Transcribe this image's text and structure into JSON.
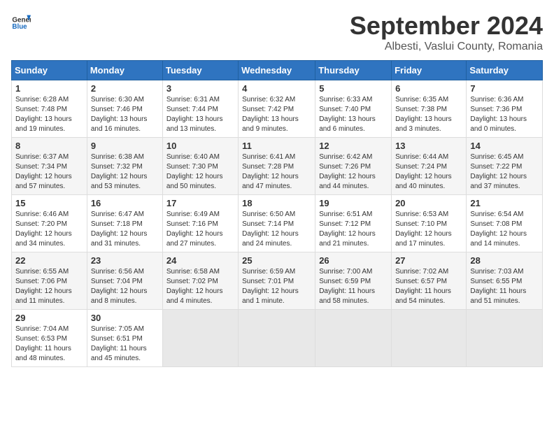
{
  "header": {
    "logo_general": "General",
    "logo_blue": "Blue",
    "title": "September 2024",
    "subtitle": "Albesti, Vaslui County, Romania"
  },
  "calendar": {
    "days_of_week": [
      "Sunday",
      "Monday",
      "Tuesday",
      "Wednesday",
      "Thursday",
      "Friday",
      "Saturday"
    ],
    "weeks": [
      [
        {
          "day": "",
          "sunrise": "",
          "sunset": "",
          "daylight": "",
          "empty": true
        },
        {
          "day": "",
          "sunrise": "",
          "sunset": "",
          "daylight": "",
          "empty": true
        },
        {
          "day": "",
          "sunrise": "",
          "sunset": "",
          "daylight": "",
          "empty": true
        },
        {
          "day": "",
          "sunrise": "",
          "sunset": "",
          "daylight": "",
          "empty": true
        },
        {
          "day": "",
          "sunrise": "",
          "sunset": "",
          "daylight": "",
          "empty": true
        },
        {
          "day": "",
          "sunrise": "",
          "sunset": "",
          "daylight": "",
          "empty": true
        },
        {
          "day": "",
          "sunrise": "",
          "sunset": "",
          "daylight": "",
          "empty": true
        }
      ],
      [
        {
          "day": "1",
          "sunrise": "Sunrise: 6:28 AM",
          "sunset": "Sunset: 7:48 PM",
          "daylight": "Daylight: 13 hours and 19 minutes.",
          "empty": false
        },
        {
          "day": "2",
          "sunrise": "Sunrise: 6:30 AM",
          "sunset": "Sunset: 7:46 PM",
          "daylight": "Daylight: 13 hours and 16 minutes.",
          "empty": false
        },
        {
          "day": "3",
          "sunrise": "Sunrise: 6:31 AM",
          "sunset": "Sunset: 7:44 PM",
          "daylight": "Daylight: 13 hours and 13 minutes.",
          "empty": false
        },
        {
          "day": "4",
          "sunrise": "Sunrise: 6:32 AM",
          "sunset": "Sunset: 7:42 PM",
          "daylight": "Daylight: 13 hours and 9 minutes.",
          "empty": false
        },
        {
          "day": "5",
          "sunrise": "Sunrise: 6:33 AM",
          "sunset": "Sunset: 7:40 PM",
          "daylight": "Daylight: 13 hours and 6 minutes.",
          "empty": false
        },
        {
          "day": "6",
          "sunrise": "Sunrise: 6:35 AM",
          "sunset": "Sunset: 7:38 PM",
          "daylight": "Daylight: 13 hours and 3 minutes.",
          "empty": false
        },
        {
          "day": "7",
          "sunrise": "Sunrise: 6:36 AM",
          "sunset": "Sunset: 7:36 PM",
          "daylight": "Daylight: 13 hours and 0 minutes.",
          "empty": false
        }
      ],
      [
        {
          "day": "8",
          "sunrise": "Sunrise: 6:37 AM",
          "sunset": "Sunset: 7:34 PM",
          "daylight": "Daylight: 12 hours and 57 minutes.",
          "empty": false
        },
        {
          "day": "9",
          "sunrise": "Sunrise: 6:38 AM",
          "sunset": "Sunset: 7:32 PM",
          "daylight": "Daylight: 12 hours and 53 minutes.",
          "empty": false
        },
        {
          "day": "10",
          "sunrise": "Sunrise: 6:40 AM",
          "sunset": "Sunset: 7:30 PM",
          "daylight": "Daylight: 12 hours and 50 minutes.",
          "empty": false
        },
        {
          "day": "11",
          "sunrise": "Sunrise: 6:41 AM",
          "sunset": "Sunset: 7:28 PM",
          "daylight": "Daylight: 12 hours and 47 minutes.",
          "empty": false
        },
        {
          "day": "12",
          "sunrise": "Sunrise: 6:42 AM",
          "sunset": "Sunset: 7:26 PM",
          "daylight": "Daylight: 12 hours and 44 minutes.",
          "empty": false
        },
        {
          "day": "13",
          "sunrise": "Sunrise: 6:44 AM",
          "sunset": "Sunset: 7:24 PM",
          "daylight": "Daylight: 12 hours and 40 minutes.",
          "empty": false
        },
        {
          "day": "14",
          "sunrise": "Sunrise: 6:45 AM",
          "sunset": "Sunset: 7:22 PM",
          "daylight": "Daylight: 12 hours and 37 minutes.",
          "empty": false
        }
      ],
      [
        {
          "day": "15",
          "sunrise": "Sunrise: 6:46 AM",
          "sunset": "Sunset: 7:20 PM",
          "daylight": "Daylight: 12 hours and 34 minutes.",
          "empty": false
        },
        {
          "day": "16",
          "sunrise": "Sunrise: 6:47 AM",
          "sunset": "Sunset: 7:18 PM",
          "daylight": "Daylight: 12 hours and 31 minutes.",
          "empty": false
        },
        {
          "day": "17",
          "sunrise": "Sunrise: 6:49 AM",
          "sunset": "Sunset: 7:16 PM",
          "daylight": "Daylight: 12 hours and 27 minutes.",
          "empty": false
        },
        {
          "day": "18",
          "sunrise": "Sunrise: 6:50 AM",
          "sunset": "Sunset: 7:14 PM",
          "daylight": "Daylight: 12 hours and 24 minutes.",
          "empty": false
        },
        {
          "day": "19",
          "sunrise": "Sunrise: 6:51 AM",
          "sunset": "Sunset: 7:12 PM",
          "daylight": "Daylight: 12 hours and 21 minutes.",
          "empty": false
        },
        {
          "day": "20",
          "sunrise": "Sunrise: 6:53 AM",
          "sunset": "Sunset: 7:10 PM",
          "daylight": "Daylight: 12 hours and 17 minutes.",
          "empty": false
        },
        {
          "day": "21",
          "sunrise": "Sunrise: 6:54 AM",
          "sunset": "Sunset: 7:08 PM",
          "daylight": "Daylight: 12 hours and 14 minutes.",
          "empty": false
        }
      ],
      [
        {
          "day": "22",
          "sunrise": "Sunrise: 6:55 AM",
          "sunset": "Sunset: 7:06 PM",
          "daylight": "Daylight: 12 hours and 11 minutes.",
          "empty": false
        },
        {
          "day": "23",
          "sunrise": "Sunrise: 6:56 AM",
          "sunset": "Sunset: 7:04 PM",
          "daylight": "Daylight: 12 hours and 8 minutes.",
          "empty": false
        },
        {
          "day": "24",
          "sunrise": "Sunrise: 6:58 AM",
          "sunset": "Sunset: 7:02 PM",
          "daylight": "Daylight: 12 hours and 4 minutes.",
          "empty": false
        },
        {
          "day": "25",
          "sunrise": "Sunrise: 6:59 AM",
          "sunset": "Sunset: 7:01 PM",
          "daylight": "Daylight: 12 hours and 1 minute.",
          "empty": false
        },
        {
          "day": "26",
          "sunrise": "Sunrise: 7:00 AM",
          "sunset": "Sunset: 6:59 PM",
          "daylight": "Daylight: 11 hours and 58 minutes.",
          "empty": false
        },
        {
          "day": "27",
          "sunrise": "Sunrise: 7:02 AM",
          "sunset": "Sunset: 6:57 PM",
          "daylight": "Daylight: 11 hours and 54 minutes.",
          "empty": false
        },
        {
          "day": "28",
          "sunrise": "Sunrise: 7:03 AM",
          "sunset": "Sunset: 6:55 PM",
          "daylight": "Daylight: 11 hours and 51 minutes.",
          "empty": false
        }
      ],
      [
        {
          "day": "29",
          "sunrise": "Sunrise: 7:04 AM",
          "sunset": "Sunset: 6:53 PM",
          "daylight": "Daylight: 11 hours and 48 minutes.",
          "empty": false
        },
        {
          "day": "30",
          "sunrise": "Sunrise: 7:05 AM",
          "sunset": "Sunset: 6:51 PM",
          "daylight": "Daylight: 11 hours and 45 minutes.",
          "empty": false
        },
        {
          "day": "",
          "sunrise": "",
          "sunset": "",
          "daylight": "",
          "empty": true
        },
        {
          "day": "",
          "sunrise": "",
          "sunset": "",
          "daylight": "",
          "empty": true
        },
        {
          "day": "",
          "sunrise": "",
          "sunset": "",
          "daylight": "",
          "empty": true
        },
        {
          "day": "",
          "sunrise": "",
          "sunset": "",
          "daylight": "",
          "empty": true
        },
        {
          "day": "",
          "sunrise": "",
          "sunset": "",
          "daylight": "",
          "empty": true
        }
      ]
    ]
  }
}
